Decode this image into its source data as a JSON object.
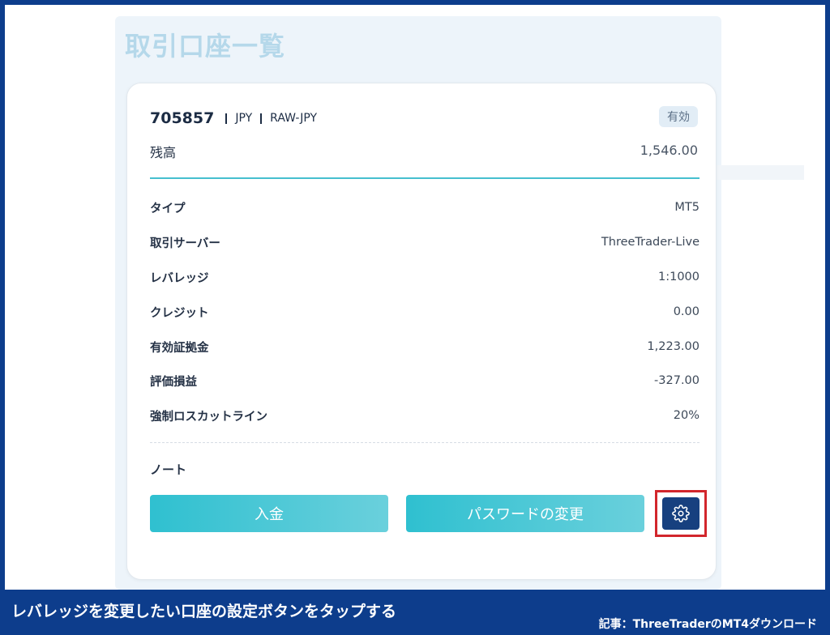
{
  "page": {
    "title": "取引口座一覧"
  },
  "account": {
    "number": "705857",
    "currency": "JPY",
    "account_type": "RAW-JPY",
    "status": "有効",
    "balance_label": "残高",
    "balance_value": "1,546.00"
  },
  "details": [
    {
      "label": "タイプ",
      "value": "MT5"
    },
    {
      "label": "取引サーバー",
      "value": "ThreeTrader-Live"
    },
    {
      "label": "レバレッジ",
      "value": "1:1000"
    },
    {
      "label": "クレジット",
      "value": "0.00"
    },
    {
      "label": "有効証拠金",
      "value": "1,223.00"
    },
    {
      "label": "評価損益",
      "value": "-327.00"
    },
    {
      "label": "強制ロスカットライン",
      "value": "20%"
    }
  ],
  "note": {
    "label": "ノート"
  },
  "actions": {
    "deposit_label": "入金",
    "password_label": "パスワードの変更",
    "settings_icon": "gear-icon"
  },
  "caption": {
    "main": "レバレッジを変更したい口座の設定ボタンをタップする",
    "source": "記事：ThreeTraderのMT4ダウンロード"
  },
  "colors": {
    "frame": "#0d3d8c",
    "accent_teal": "#45bfcf",
    "settings_button": "#17407f",
    "highlight": "#d2262c"
  }
}
